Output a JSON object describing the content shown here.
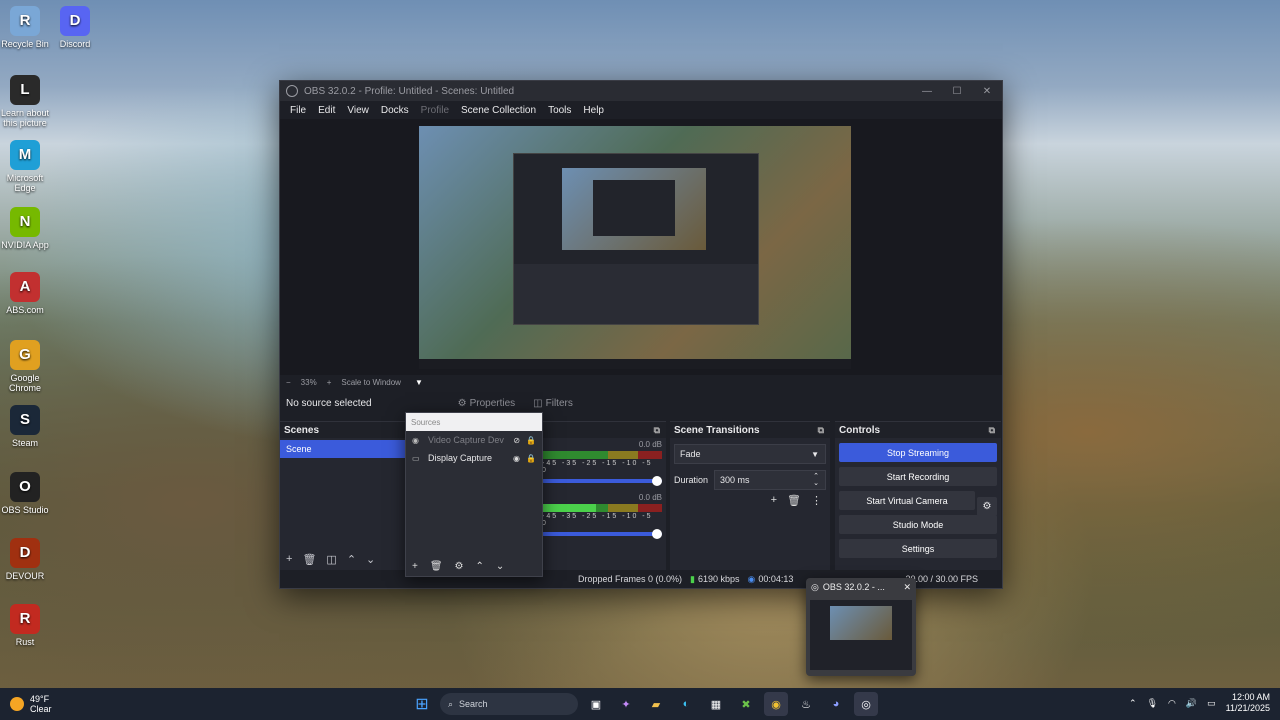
{
  "desktop": {
    "icons": [
      {
        "label": "Recycle Bin",
        "icon": "recycle-bin-icon",
        "color": "#7aa7d6"
      },
      {
        "label": "Discord",
        "icon": "discord-icon",
        "color": "#5865f2"
      },
      {
        "label": "Learn about this picture",
        "icon": "camera-icon",
        "color": "#2a2a2a"
      },
      {
        "label": "Microsoft Edge",
        "icon": "edge-icon",
        "color": "#1f9fd6"
      },
      {
        "label": "NVIDIA App",
        "icon": "nvidia-icon",
        "color": "#76b900"
      },
      {
        "label": "ABS.com",
        "icon": "abs-icon",
        "color": "#c23030"
      },
      {
        "label": "Google Chrome",
        "icon": "chrome-icon",
        "color": "#e0a020"
      },
      {
        "label": "Steam",
        "icon": "steam-icon",
        "color": "#1b2838"
      },
      {
        "label": "OBS Studio",
        "icon": "obs-icon",
        "color": "#222"
      },
      {
        "label": "DEVOUR",
        "icon": "devour-icon",
        "color": "#a03010"
      },
      {
        "label": "Rust",
        "icon": "rust-icon",
        "color": "#c22a20"
      }
    ]
  },
  "obs": {
    "title": "OBS 32.0.2 - Profile: Untitled - Scenes: Untitled",
    "menu": [
      "File",
      "Edit",
      "View",
      "Docks",
      "Profile",
      "Scene Collection",
      "Tools",
      "Help"
    ],
    "zoom": {
      "minus": "−",
      "level": "33%",
      "plus": "+",
      "mode": "Scale to Window",
      "chevron": "▼"
    },
    "source_bar": {
      "status": "No source selected",
      "properties": "Properties",
      "filters": "Filters"
    },
    "scenes": {
      "title": "Scenes",
      "items": [
        "Scene"
      ]
    },
    "sources": {
      "title": "Sources",
      "items": [
        {
          "name": "Video Capture Dev",
          "visible": false
        },
        {
          "name": "Display Capture",
          "visible": true
        }
      ]
    },
    "mixer": {
      "tracks": [
        {
          "db": "0.0 dB",
          "scale": "-45 -35 -25 -15 -10 -5 0"
        },
        {
          "db": "0.0 dB",
          "scale": "-45 -35 -25 -15 -10 -5 0"
        }
      ]
    },
    "transitions": {
      "title": "Scene Transitions",
      "selected": "Fade",
      "duration_label": "Duration",
      "duration_value": "300 ms"
    },
    "controls": {
      "title": "Controls",
      "stop_streaming": "Stop Streaming",
      "start_recording": "Start Recording",
      "start_virtual_camera": "Start Virtual Camera",
      "studio_mode": "Studio Mode",
      "settings": "Settings"
    },
    "status": {
      "dropped": "Dropped Frames 0 (0.0%)",
      "bitrate": "6190 kbps",
      "time": "00:04:13",
      "fps": "30.00 / 30.00 FPS"
    },
    "accent": "#3b5bdb"
  },
  "thumbnail": {
    "title": "OBS 32.0.2 - ..."
  },
  "taskbar": {
    "weather_temp": "49°F",
    "weather_desc": "Clear",
    "search_placeholder": "Search",
    "time": "12:00 AM",
    "date": "11/21/2025"
  }
}
